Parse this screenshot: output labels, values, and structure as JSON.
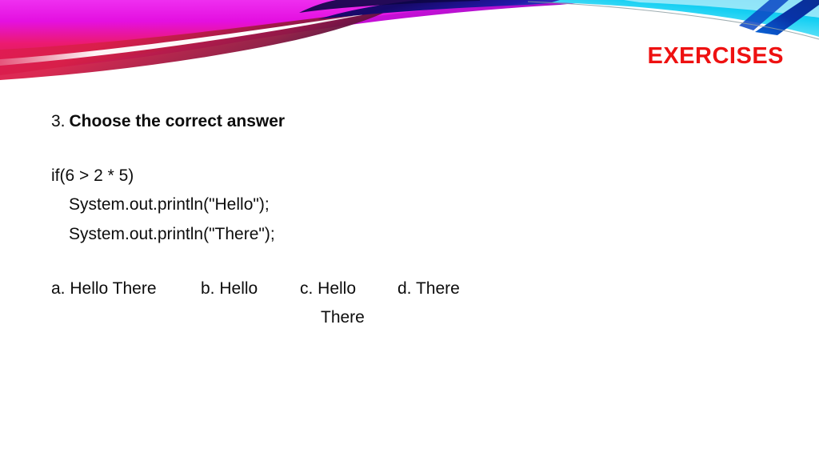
{
  "slide": {
    "title": "EXERCISES",
    "title_color": "#ee1111",
    "background_color": "#ffffff",
    "body_text_color": "#0d0d0d"
  },
  "question": {
    "number": "3.",
    "prompt": "Choose the correct answer"
  },
  "code": {
    "lines": [
      "if(6 > 2 * 5)",
      "System.out.println(\"Hello\");",
      "System.out.println(\"There\");"
    ]
  },
  "options": [
    {
      "label": "a. Hello There",
      "second_line": ""
    },
    {
      "label": "b. Hello",
      "second_line": ""
    },
    {
      "label": "c. Hello",
      "second_line": "There"
    },
    {
      "label": "d. There",
      "second_line": ""
    }
  ],
  "banner": {
    "name": "decorative-wave-banner",
    "colors": {
      "magenta": "#e40fe0",
      "pink": "#ec1a6a",
      "crimson": "#cf1f45",
      "purple": "#7a10b8",
      "navy": "#120a5e",
      "deep_blue": "#0a3fb0",
      "cyan": "#17d8f5",
      "light_cyan": "#9ef0fb",
      "white_streak": "#ffffff",
      "grey_curve": "#9aa7a8"
    }
  }
}
